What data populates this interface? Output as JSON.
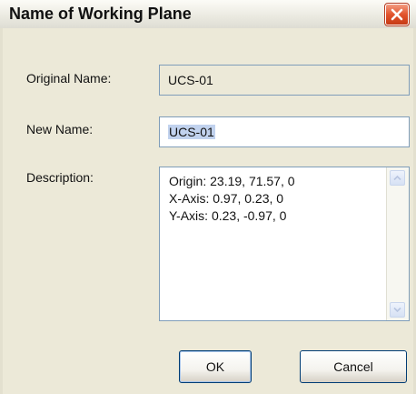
{
  "window": {
    "title": "Name of Working Plane",
    "close_icon": "close-icon"
  },
  "form": {
    "original_name_label": "Original Name:",
    "original_name_value": "UCS-01",
    "new_name_label": "New Name:",
    "new_name_value": "UCS-01",
    "description_label": "Description:",
    "description_lines": [
      "Origin: 23.19, 71.57, 0",
      "X-Axis: 0.97, 0.23, 0",
      "Y-Axis: 0.23, -0.97, 0"
    ]
  },
  "buttons": {
    "ok_label": "OK",
    "cancel_label": "Cancel"
  },
  "colors": {
    "close_button": "#e2542d",
    "dialog_background": "#ece9d8",
    "selection_highlight": "#c1d2ee",
    "field_border": "#7f9db9"
  }
}
